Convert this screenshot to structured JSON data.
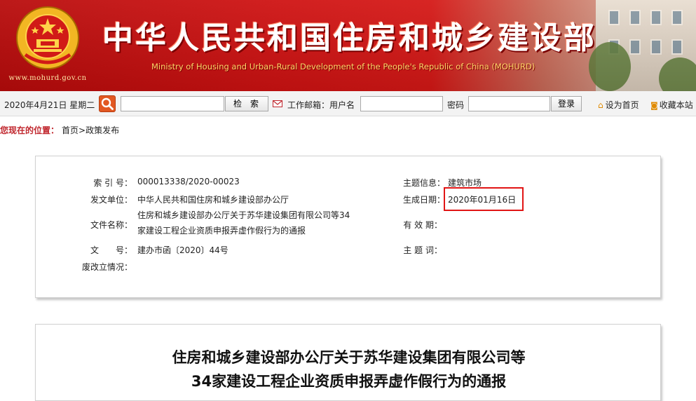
{
  "banner": {
    "site_url": "www.mohurd.gov.cn",
    "title_cn": "中华人民共和国住房和城乡建设部",
    "title_en": "Ministry of Housing and Urban-Rural Development of the People's Republic of China (MOHURD)"
  },
  "toolbar": {
    "date": "2020年4月21日 星期二",
    "search_button_label": "检索",
    "mail_label": "工作邮箱：用户名",
    "password_label": "密码",
    "login_button_label": "登录",
    "set_home_label": "设为首页",
    "favorite_label": "收藏本站"
  },
  "breadcrumb": {
    "label": "您现在的位置：",
    "path": "首页>政策发布"
  },
  "info": {
    "index_label": "索 引 号：",
    "index_value": "000013338/2020-00023",
    "issuer_label": "发文单位：",
    "issuer_value": "中华人民共和国住房和城乡建设部办公厅",
    "name_label": "文件名称：",
    "name_value": "住房和城乡建设部办公厅关于苏华建设集团有限公司等34家建设工程企业资质申报弄虚作假行为的通报",
    "docno_label": "文　　号：",
    "docno_value": "建办市函〔2020〕44号",
    "status_label": "废改立情况：",
    "status_value": "",
    "topic_label": "主题信息：",
    "topic_value": "建筑市场",
    "date_label": "生成日期：",
    "date_value": "2020年01月16日",
    "valid_label": "有 效 期：",
    "valid_value": "",
    "keyword_label": "主 题 词：",
    "keyword_value": ""
  },
  "article": {
    "title_line1": "住房和城乡建设部办公厅关于苏华建设集团有限公司等",
    "title_line2": "34家建设工程企业资质申报弄虚作假行为的通报"
  },
  "colors": {
    "banner_red": "#cf1212",
    "highlight_red": "#e11515",
    "breadcrumb_red": "#c0262d"
  }
}
